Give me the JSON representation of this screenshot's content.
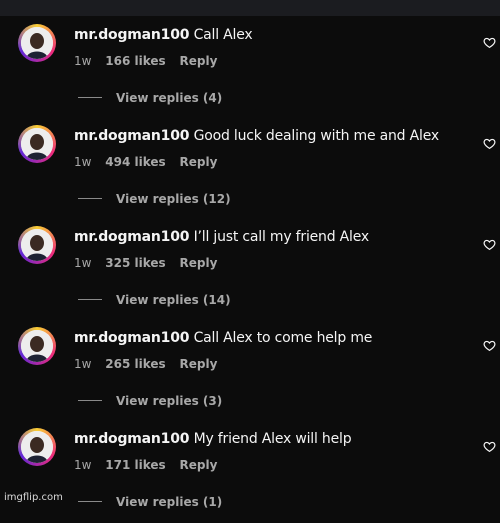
{
  "comments": [
    {
      "username": "mr.dogman100",
      "text": "Call Alex",
      "time": "1w",
      "likes": "166 likes",
      "reply": "Reply",
      "view_replies": "View replies (4)"
    },
    {
      "username": "mr.dogman100",
      "text": "Good luck dealing with me and Alex",
      "time": "1w",
      "likes": "494 likes",
      "reply": "Reply",
      "view_replies": "View replies (12)"
    },
    {
      "username": "mr.dogman100",
      "text": "I’ll just call my friend Alex",
      "time": "1w",
      "likes": "325 likes",
      "reply": "Reply",
      "view_replies": "View replies (14)"
    },
    {
      "username": "mr.dogman100",
      "text": "Call Alex to come help me",
      "time": "1w",
      "likes": "265 likes",
      "reply": "Reply",
      "view_replies": "View replies (3)"
    },
    {
      "username": "mr.dogman100",
      "text": "My friend Alex will help",
      "time": "1w",
      "likes": "171 likes",
      "reply": "Reply",
      "view_replies": "View replies (1)"
    }
  ],
  "icons": {
    "like": "heart-icon",
    "avatar": "profile-avatar"
  },
  "colors": {
    "background": "#0c0c0c",
    "text": "#f5f5f5",
    "secondary": "#a8a8a8"
  },
  "watermark": "imgflip.com"
}
